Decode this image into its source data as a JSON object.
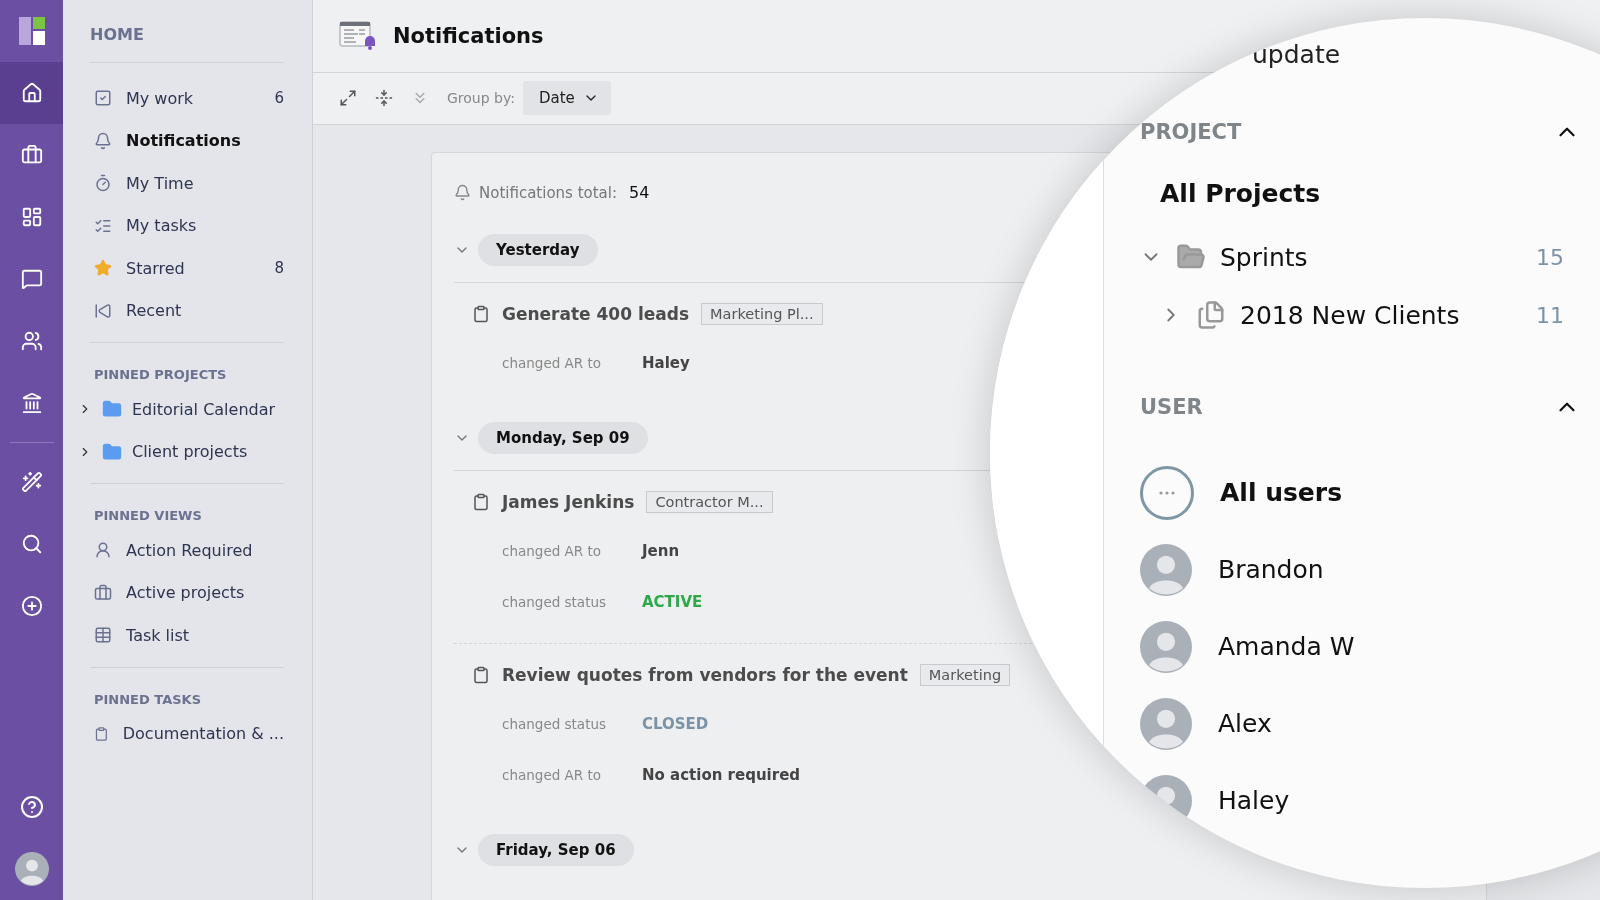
{
  "rail": {
    "items": [
      {
        "selected": true
      },
      {
        "selected": false
      },
      {
        "selected": false
      },
      {
        "selected": false
      },
      {
        "selected": false
      },
      {
        "selected": false
      },
      {
        "selected": false
      },
      {
        "selected": false
      },
      {
        "selected": false
      }
    ]
  },
  "sidebar": {
    "title": "HOME",
    "items": [
      {
        "label": "My work",
        "count": "6",
        "selected": false
      },
      {
        "label": "Notifications",
        "selected": true
      },
      {
        "label": "My Time",
        "selected": false
      },
      {
        "label": "My tasks",
        "selected": false
      },
      {
        "label": "Starred",
        "count": "8",
        "selected": false
      },
      {
        "label": "Recent",
        "selected": false
      }
    ],
    "sections": [
      {
        "title": "PINNED PROJECTS",
        "kind": "projects",
        "items": [
          {
            "label": "Editorial Calendar",
            "expanded": false
          },
          {
            "label": "Client projects",
            "expanded": false
          }
        ]
      },
      {
        "title": "PINNED VIEWS",
        "kind": "views",
        "items": [
          {
            "label": "Action Required"
          },
          {
            "label": "Active projects"
          },
          {
            "label": "Task list"
          }
        ]
      },
      {
        "title": "PINNED TASKS",
        "kind": "tasks",
        "items": [
          {
            "label": "Documentation & ..."
          }
        ]
      }
    ]
  },
  "header": {
    "title": "Notifications"
  },
  "toolbar": {
    "group_by_label": "Group by:",
    "group_by_value": "Date"
  },
  "feed": {
    "total_label": "Notifications total:",
    "total": "54",
    "groups": [
      {
        "date": "Yesterday",
        "expanded": true,
        "entries": [
          {
            "title": "Generate 400 leads",
            "tag": "Marketing Pl...",
            "changes": [
              {
                "label": "changed AR to",
                "value": "Haley",
                "kind": "text"
              }
            ]
          }
        ]
      },
      {
        "date": "Monday, Sep 09",
        "expanded": true,
        "entries": [
          {
            "title": "James Jenkins",
            "tag": "Contractor M...",
            "changes": [
              {
                "label": "changed AR to",
                "value": "Jenn",
                "kind": "text"
              },
              {
                "label": "changed status",
                "value": "ACTIVE",
                "kind": "status",
                "color": "#2ea84a"
              }
            ]
          },
          {
            "title": "Review quotes from vendors for the event",
            "tag": "Marketing",
            "changes": [
              {
                "label": "changed status",
                "value": "CLOSED",
                "kind": "status",
                "color": "#7b93a5"
              },
              {
                "label": "changed AR to",
                "value": "No action required",
                "kind": "text"
              }
            ]
          }
        ]
      },
      {
        "date": "Friday, Sep 06",
        "expanded": true
      }
    ]
  },
  "magnifier": {
    "cut_text": "update",
    "project": {
      "title": "PROJECT",
      "expanded": true,
      "all": {
        "label": "All Projects",
        "selected": true
      },
      "tree": [
        {
          "label": "Sprints",
          "count": "15",
          "expanded": true,
          "children": [
            {
              "label": "2018 New Clients",
              "count": "11",
              "expanded": false
            }
          ]
        }
      ]
    },
    "user": {
      "title": "USER",
      "expanded": true,
      "items": [
        {
          "name": "All users",
          "kind": "all",
          "selected": true
        },
        {
          "name": "Brandon",
          "kind": "person",
          "selected": false
        },
        {
          "name": "Amanda W",
          "kind": "person",
          "selected": false
        },
        {
          "name": "Alex",
          "kind": "person",
          "selected": false
        },
        {
          "name": "Haley",
          "kind": "person",
          "selected": false
        }
      ]
    }
  }
}
